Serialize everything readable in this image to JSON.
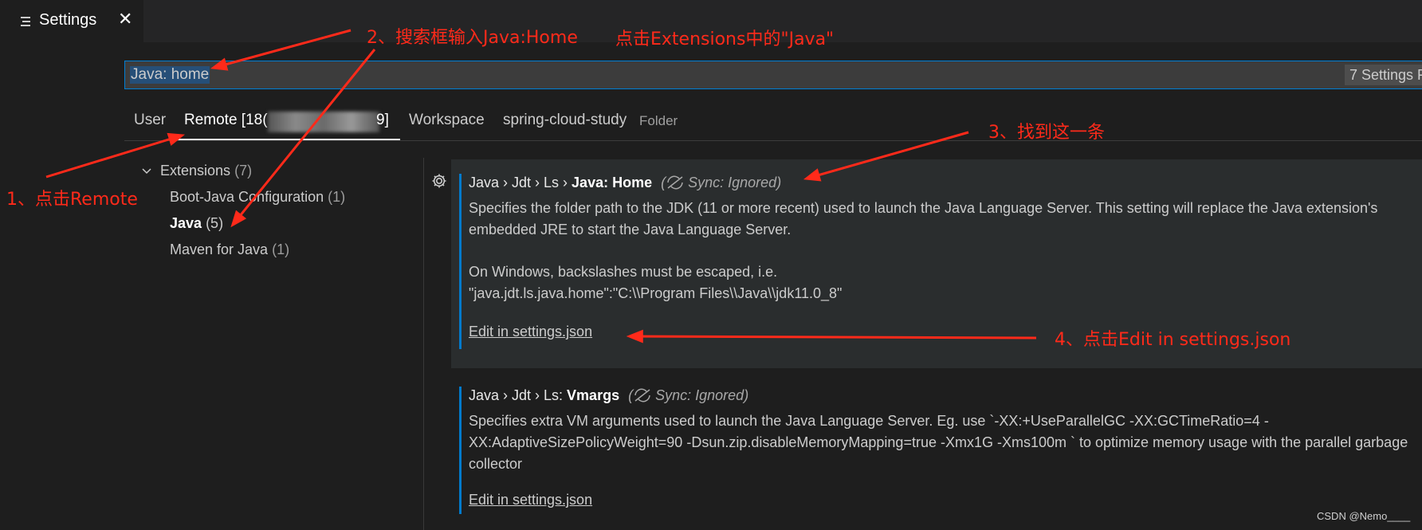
{
  "editor_tab": {
    "title": "Settings",
    "close": "✕"
  },
  "search": {
    "value": "Java: home",
    "result_count": "7 Settings F"
  },
  "scope_tabs": {
    "user": "User",
    "remote": "Remote [18(",
    "remote_tail": "9]",
    "workspace": "Workspace",
    "folder": "spring-cloud-study",
    "folder_hint": "Folder"
  },
  "toc": {
    "extensions": "Extensions",
    "extensions_count": "(7)",
    "boot_java": "Boot-Java Configuration",
    "boot_java_count": "(1)",
    "java": "Java",
    "java_count": "(5)",
    "maven": "Maven for Java",
    "maven_count": "(1)"
  },
  "settings": [
    {
      "breadcrumb": "Java › Jdt › Ls › ",
      "name": "Java: Home",
      "sync": "Sync: Ignored",
      "desc1": "Specifies the folder path to the JDK (11 or more recent) used to launch the Java Language Server. This setting will replace the Java extension's",
      "desc2": "embedded JRE to start the Java Language Server.",
      "desc3": "On Windows, backslashes must be escaped, i.e.",
      "desc4": "\"java.jdt.ls.java.home\":\"C:\\\\Program Files\\\\Java\\\\jdk11.0_8\"",
      "link": "Edit in settings.json"
    },
    {
      "breadcrumb": "Java › Jdt › Ls: ",
      "name": "Vmargs",
      "sync": "Sync: Ignored",
      "desc1": "Specifies extra VM arguments used to launch the Java Language Server. Eg. use `-XX:+UseParallelGC -XX:GCTimeRatio=4 -",
      "desc2": "XX:AdaptiveSizePolicyWeight=90 -Dsun.zip.disableMemoryMapping=true -Xmx1G -Xms100m ` to optimize memory usage with the parallel garbage",
      "desc3": "collector",
      "link": "Edit in settings.json"
    }
  ],
  "annotations": {
    "step1": "1、点击Remote",
    "step2": "2、搜索框输入Java:Home",
    "step2b": "点击Extensions中的\"Java\"",
    "step3": "3、找到这一条",
    "step4": "4、点击Edit in settings.json"
  },
  "watermark": "CSDN @Nemo____",
  "colors": {
    "accent": "#007acc",
    "annotation": "#ff2a1a",
    "background": "#1e1e1e"
  }
}
